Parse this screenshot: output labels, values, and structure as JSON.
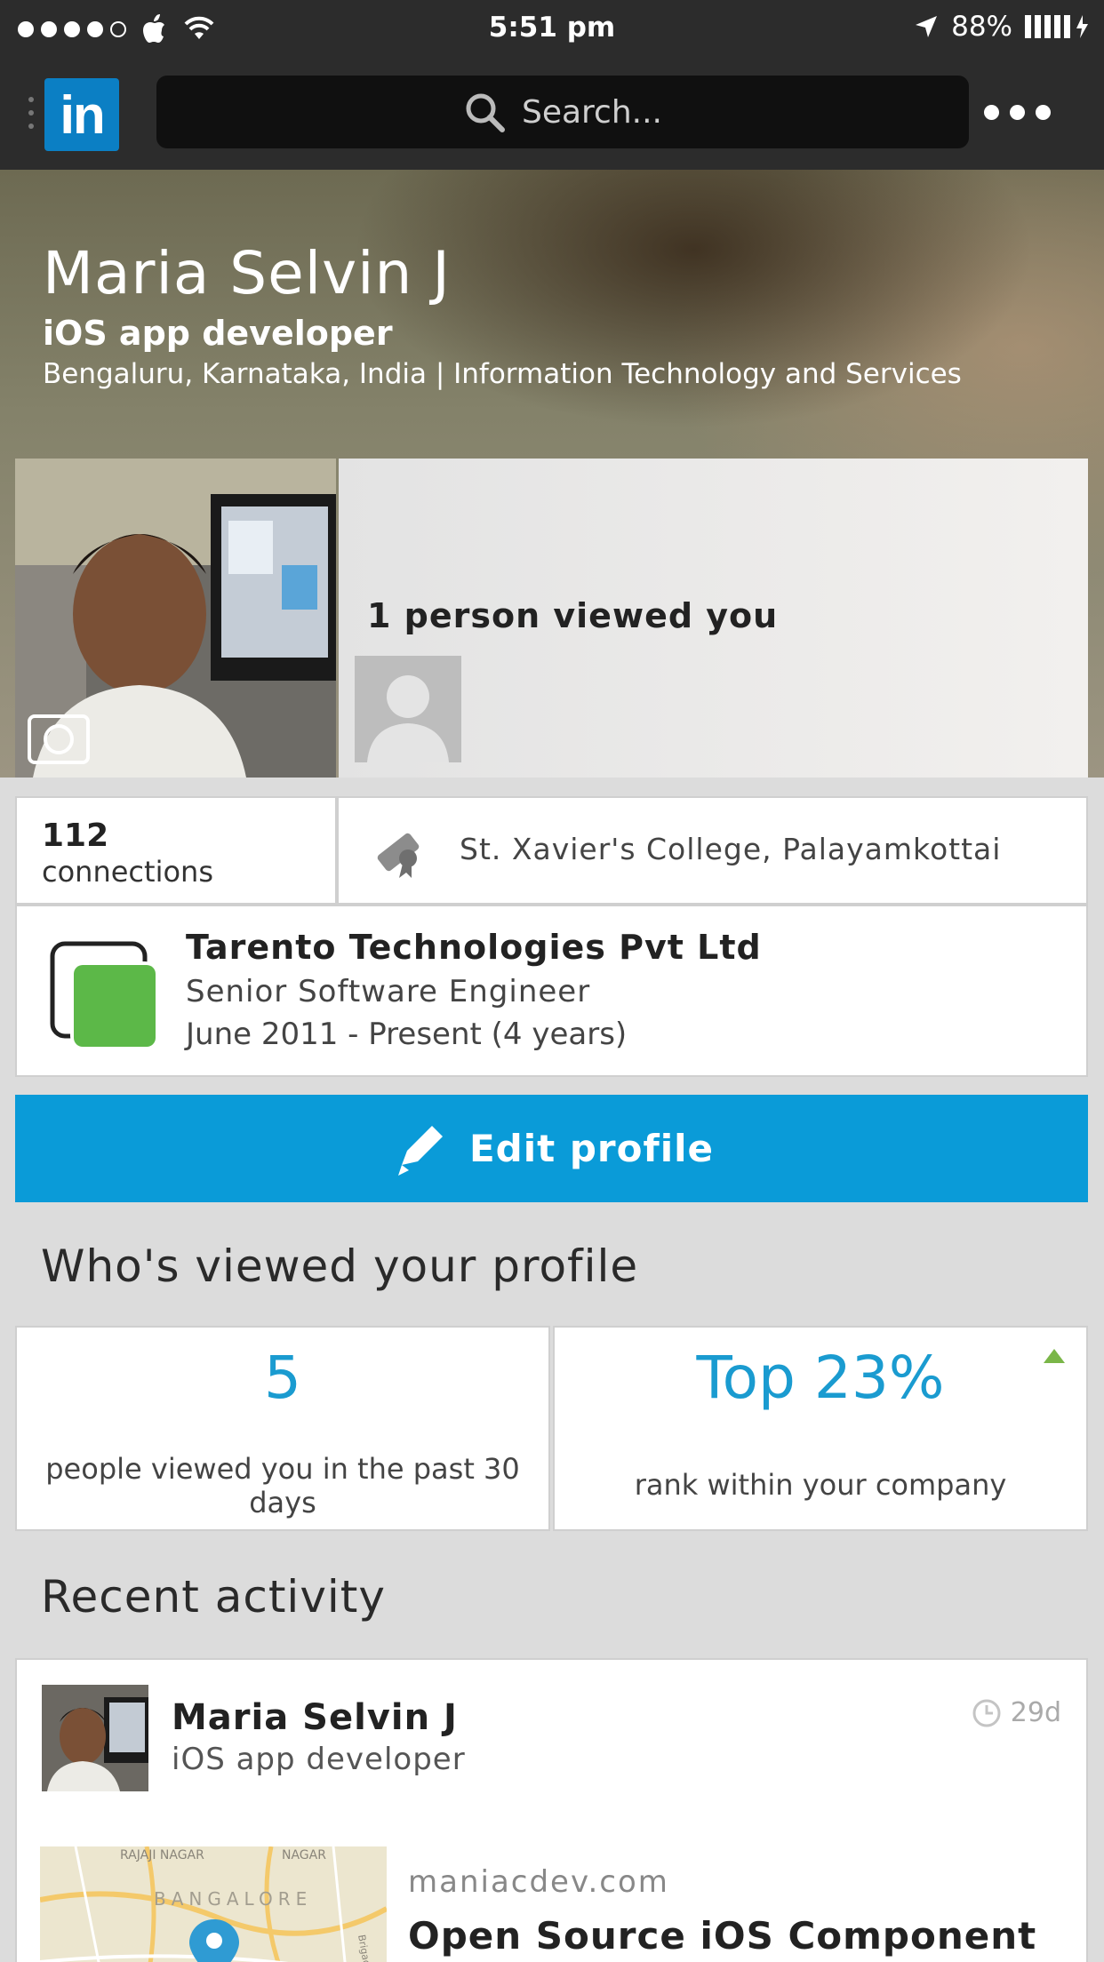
{
  "status_bar": {
    "time": "5:51 pm",
    "battery": "88%"
  },
  "nav": {
    "logo_text": "in",
    "search_placeholder": "Search..."
  },
  "profile": {
    "name": "Maria Selvin J",
    "headline": "iOS app developer",
    "location_line": "Bengaluru, Karnataka, India | Information Technology and Services"
  },
  "viewers_teaser": {
    "text": "1 person viewed you"
  },
  "connections": {
    "count": "112",
    "label": "connections"
  },
  "education": {
    "school": "St. Xavier's College, Palayamkottai"
  },
  "position": {
    "company": "Tarento Technologies Pvt Ltd",
    "title": "Senior Software Engineer",
    "dates": "June 2011 - Present (4 years)",
    "logo_color": "#5cb848"
  },
  "edit_button": {
    "label": "Edit profile"
  },
  "who_viewed": {
    "section_title": "Who's viewed your profile",
    "views_count": "5",
    "views_desc": "people viewed you in the past 30 days",
    "rank": "Top 23%",
    "rank_desc": "rank within your company"
  },
  "recent_activity": {
    "section_title": "Recent activity",
    "author": "Maria Selvin J",
    "author_headline": "iOS app developer",
    "age": "29d",
    "link_domain": "maniacdev.com",
    "link_title": "Open Source iOS Component",
    "map_labels": [
      "RAJAJI NAGAR",
      "NAGAR",
      "BANGALORE",
      "Brigade Rd"
    ]
  },
  "colors": {
    "accent": "#0a9bd8",
    "linkedin_blue": "#0b7fc4",
    "stat_blue": "#1a9bd0",
    "trend_green": "#7ab648"
  }
}
